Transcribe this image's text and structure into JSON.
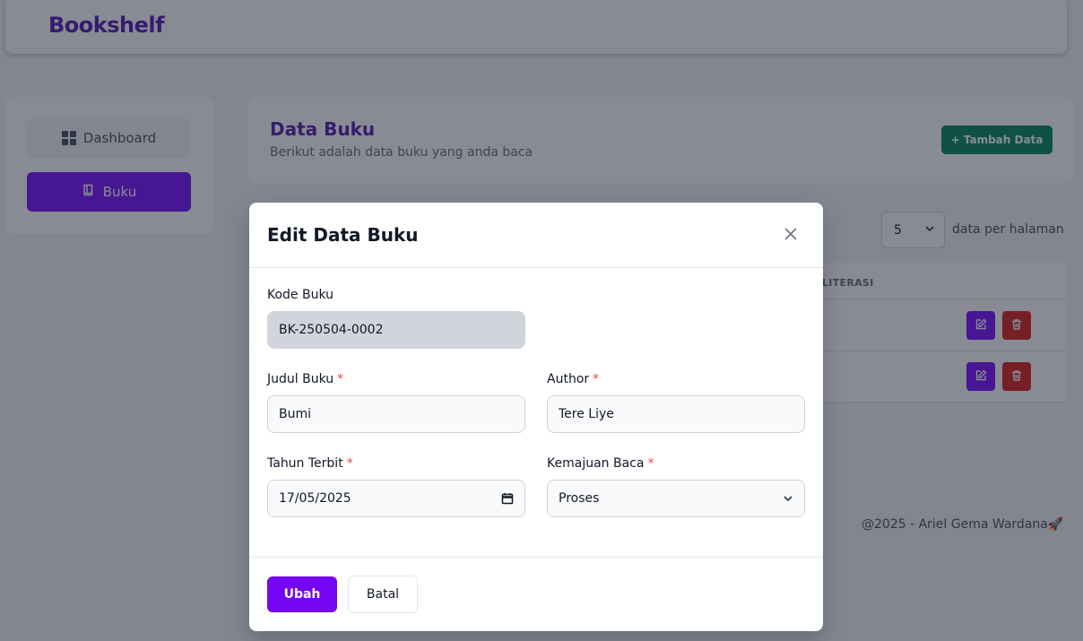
{
  "app": {
    "brand": "Bookshelf"
  },
  "sidebar": {
    "items": [
      {
        "label": "Dashboard",
        "icon": "grid-icon",
        "active": false
      },
      {
        "label": "Buku",
        "icon": "book-icon",
        "active": true
      }
    ]
  },
  "header": {
    "title": "Data Buku",
    "subtitle": "Berikut adalah data buku yang anda baca",
    "add_button": "+ Tambah Data"
  },
  "pagination": {
    "per_page_value": "5",
    "per_page_label": "data per halaman"
  },
  "table": {
    "visible_header": "LITERASI",
    "rows": 2
  },
  "footer": {
    "text": "@2025 - Ariel Gema Wardana🚀"
  },
  "modal": {
    "title": "Edit Data Buku",
    "fields": {
      "kode": {
        "label": "Kode Buku",
        "value": "BK-250504-0002",
        "disabled": true
      },
      "judul": {
        "label": "Judul Buku",
        "required_mark": "*",
        "value": "Bumi"
      },
      "author": {
        "label": "Author",
        "required_mark": "*",
        "value": "Tere Liye"
      },
      "tahun": {
        "label": "Tahun Terbit",
        "required_mark": "*",
        "value": "17/05/2025"
      },
      "kemajuan": {
        "label": "Kemajuan Baca",
        "required_mark": "*",
        "value": "Proses"
      }
    },
    "submit_label": "Ubah",
    "cancel_label": "Batal"
  },
  "colors": {
    "primary": "#7c14ff",
    "brand_text": "#5b21b6",
    "success": "#0e8a66",
    "danger": "#dc2626"
  }
}
